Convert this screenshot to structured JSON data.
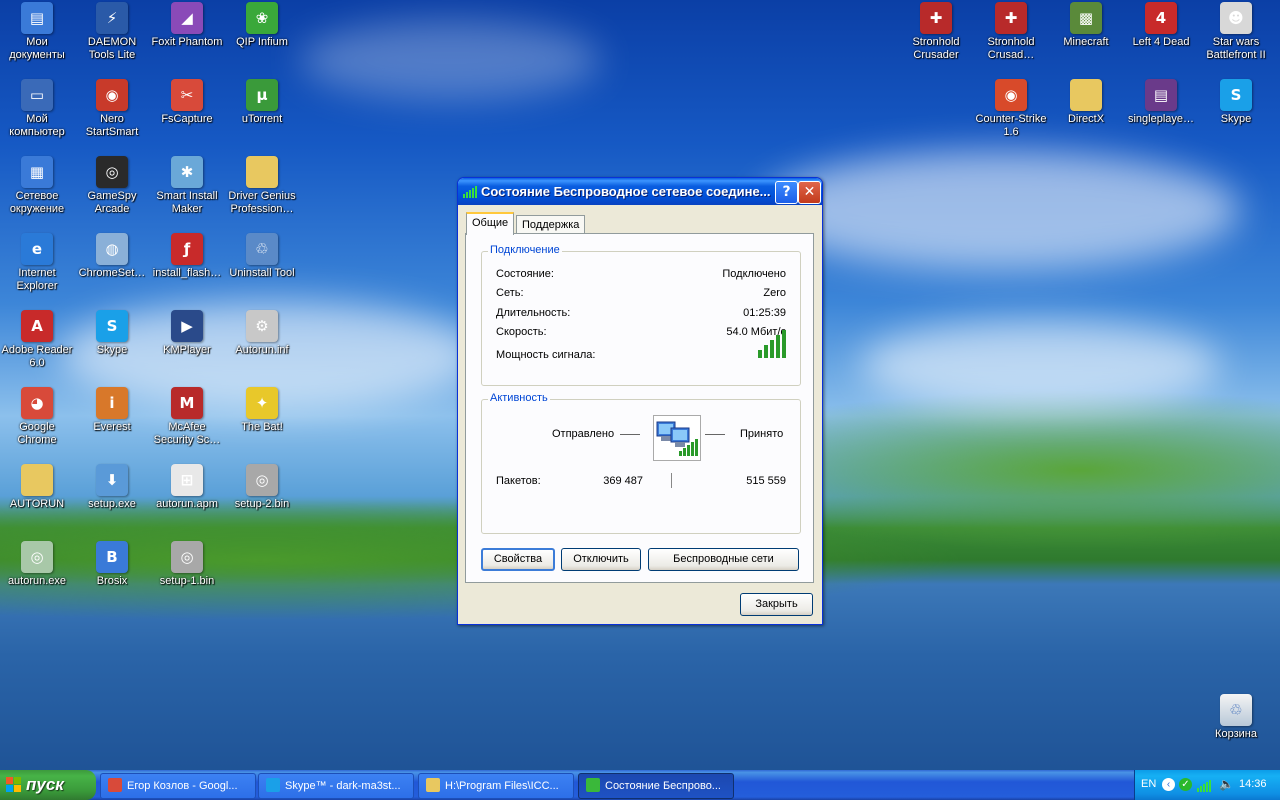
{
  "desktop": {
    "icons_left": [
      {
        "label": "Мои документы",
        "icon": "my-documents-icon",
        "color": "#3a7ad8",
        "glyph": "▤"
      },
      {
        "label": "DAEMON Tools Lite",
        "icon": "daemon-tools-icon",
        "color": "#2a5aa8",
        "glyph": "⚡"
      },
      {
        "label": "Foxit Phantom",
        "icon": "foxit-phantom-icon",
        "color": "#8a4ab8",
        "glyph": "◢"
      },
      {
        "label": "QIP Infium",
        "icon": "qip-infium-icon",
        "color": "#3aa83a",
        "glyph": "❀"
      },
      {
        "label": "Мой компьютер",
        "icon": "my-computer-icon",
        "color": "#3a6ab8",
        "glyph": "▭"
      },
      {
        "label": "Nero StartSmart",
        "icon": "nero-icon",
        "color": "#c83a2a",
        "glyph": "◉"
      },
      {
        "label": "FsCapture",
        "icon": "fscapture-icon",
        "color": "#d84a3a",
        "glyph": "✂"
      },
      {
        "label": "uTorrent",
        "icon": "utorrent-icon",
        "color": "#3a9a3a",
        "glyph": "µ"
      },
      {
        "label": "Сетевое окружение",
        "icon": "network-places-icon",
        "color": "#3a7ad8",
        "glyph": "▦"
      },
      {
        "label": "GameSpy Arcade",
        "icon": "gamespy-icon",
        "color": "#2a2a2a",
        "glyph": "◎"
      },
      {
        "label": "Smart Install Maker",
        "icon": "smart-install-icon",
        "color": "#6aa8d8",
        "glyph": "✱"
      },
      {
        "label": "Driver Genius Profession…",
        "icon": "folder-icon",
        "color": "#e8c860",
        "glyph": ""
      },
      {
        "label": "Internet Explorer",
        "icon": "internet-explorer-icon",
        "color": "#2a7ad8",
        "glyph": "e"
      },
      {
        "label": "ChromeSet…",
        "icon": "chrome-setup-icon",
        "color": "#8ab0d8",
        "glyph": "◍"
      },
      {
        "label": "install_flash…",
        "icon": "flash-installer-icon",
        "color": "#c82a2a",
        "glyph": "ƒ"
      },
      {
        "label": "Uninstall Tool",
        "icon": "uninstall-tool-icon",
        "color": "#5a8ac8",
        "glyph": "♲"
      },
      {
        "label": "Adobe Reader 6.0",
        "icon": "adobe-reader-icon",
        "color": "#c82a2a",
        "glyph": "A"
      },
      {
        "label": "Skype",
        "icon": "skype-icon",
        "color": "#1aa0e8",
        "glyph": "S"
      },
      {
        "label": "KMPlayer",
        "icon": "kmplayer-icon",
        "color": "#2a4a8a",
        "glyph": "▶"
      },
      {
        "label": "Autorun.inf",
        "icon": "settings-file-icon",
        "color": "#c8c8c8",
        "glyph": "⚙"
      },
      {
        "label": "Google Chrome",
        "icon": "google-chrome-icon",
        "color": "#d84a3a",
        "glyph": "◕"
      },
      {
        "label": "Everest",
        "icon": "everest-icon",
        "color": "#d8782a",
        "glyph": "i"
      },
      {
        "label": "McAfee Security Sc…",
        "icon": "mcafee-icon",
        "color": "#b82a2a",
        "glyph": "M"
      },
      {
        "label": "The Bat!",
        "icon": "the-bat-icon",
        "color": "#e8c82a",
        "glyph": "✦"
      },
      {
        "label": "AUTORUN",
        "icon": "folder-icon",
        "color": "#e8c860",
        "glyph": ""
      },
      {
        "label": "setup.exe",
        "icon": "setup-exe-icon",
        "color": "#5a9ad8",
        "glyph": "⬇"
      },
      {
        "label": "autorun.apm",
        "icon": "windows-file-icon",
        "color": "#e8e8e8",
        "glyph": "⊞"
      },
      {
        "label": "setup-2.bin",
        "icon": "disc-image-icon",
        "color": "#a8a8a8",
        "glyph": "◎"
      },
      {
        "label": "autorun.exe",
        "icon": "cd-autorun-icon",
        "color": "#a8c8a8",
        "glyph": "◎"
      },
      {
        "label": "Brosix",
        "icon": "brosix-icon",
        "color": "#3a7ad8",
        "glyph": "B"
      },
      {
        "label": "setup-1.bin",
        "icon": "disc-image-icon",
        "color": "#a8a8a8",
        "glyph": "◎"
      }
    ],
    "icons_right": [
      {
        "label": "Stronhold Crusader",
        "icon": "stronghold-crusader-icon",
        "color": "#b82a2a",
        "glyph": "✚"
      },
      {
        "label": "Stronhold Crusad…",
        "icon": "stronghold-crusader-icon",
        "color": "#b82a2a",
        "glyph": "✚"
      },
      {
        "label": "Minecraft",
        "icon": "minecraft-icon",
        "color": "#5a8a3a",
        "glyph": "▩"
      },
      {
        "label": "Left 4 Dead",
        "icon": "left-4-dead-icon",
        "color": "#c82a2a",
        "glyph": "4"
      },
      {
        "label": "Star wars Battlefront II",
        "icon": "star-wars-icon",
        "color": "#d8d8d8",
        "glyph": "☻"
      },
      {
        "label": "Counter-Strike 1.6",
        "icon": "counter-strike-icon",
        "color": "#d84a2a",
        "glyph": "◉"
      },
      {
        "label": "DirectX",
        "icon": "folder-icon",
        "color": "#e8c860",
        "glyph": ""
      },
      {
        "label": "singleplaye…",
        "icon": "winrar-icon",
        "color": "#6a3a8a",
        "glyph": "▤"
      },
      {
        "label": "Skype",
        "icon": "skype-icon",
        "color": "#1aa0e8",
        "glyph": "S"
      }
    ],
    "recycle_bin": {
      "label": "Корзина",
      "icon": "recycle-bin-icon"
    }
  },
  "dialog": {
    "title": "Состояние Беспроводное сетевое соедине...",
    "help_glyph": "?",
    "close_glyph": "✕",
    "tabs": [
      "Общие",
      "Поддержка"
    ],
    "connection": {
      "legend": "Подключение",
      "rows": [
        {
          "label": "Состояние:",
          "value": "Подключено"
        },
        {
          "label": "Сеть:",
          "value": "Zero"
        },
        {
          "label": "Длительность:",
          "value": "01:25:39"
        },
        {
          "label": "Скорость:",
          "value": "54.0 Мбит/с"
        }
      ],
      "signal_label": "Мощность сигнала:",
      "signal_bars": 5,
      "signal_bars_max": 5
    },
    "activity": {
      "legend": "Активность",
      "sent_label": "Отправлено",
      "received_label": "Принято",
      "packets_label": "Пакетов:",
      "packets_sent": "369 487",
      "packets_received": "515 559"
    },
    "buttons": {
      "properties": "Свойства",
      "disconnect": "Отключить",
      "wireless_networks": "Беспроводные сети",
      "close": "Закрыть"
    }
  },
  "taskbar": {
    "start_label": "пуск",
    "tasks": [
      {
        "label": "Егор Козлов - Googl...",
        "icon": "google-chrome-icon",
        "color": "#d84a3a",
        "active": false
      },
      {
        "label": "Skype™ - dark-ma3st...",
        "icon": "skype-icon",
        "color": "#1aa0e8",
        "active": false
      },
      {
        "label": "H:\\Program Files\\ICC...",
        "icon": "folder-icon",
        "color": "#e8c860",
        "active": false
      },
      {
        "label": "Состояние Беспрово...",
        "icon": "wireless-signal-icon",
        "color": "#3ab83a",
        "active": true
      }
    ],
    "tray": {
      "language": "EN",
      "clock": "14:36"
    }
  },
  "colors": {
    "xp_title_blue": "#0a5ee0",
    "dialog_face": "#ece9d8",
    "group_legend_blue": "#0046d5",
    "taskbar_blue": "#245edb",
    "start_green": "#3a9a3a",
    "signal_green": "#2a9a2a"
  }
}
